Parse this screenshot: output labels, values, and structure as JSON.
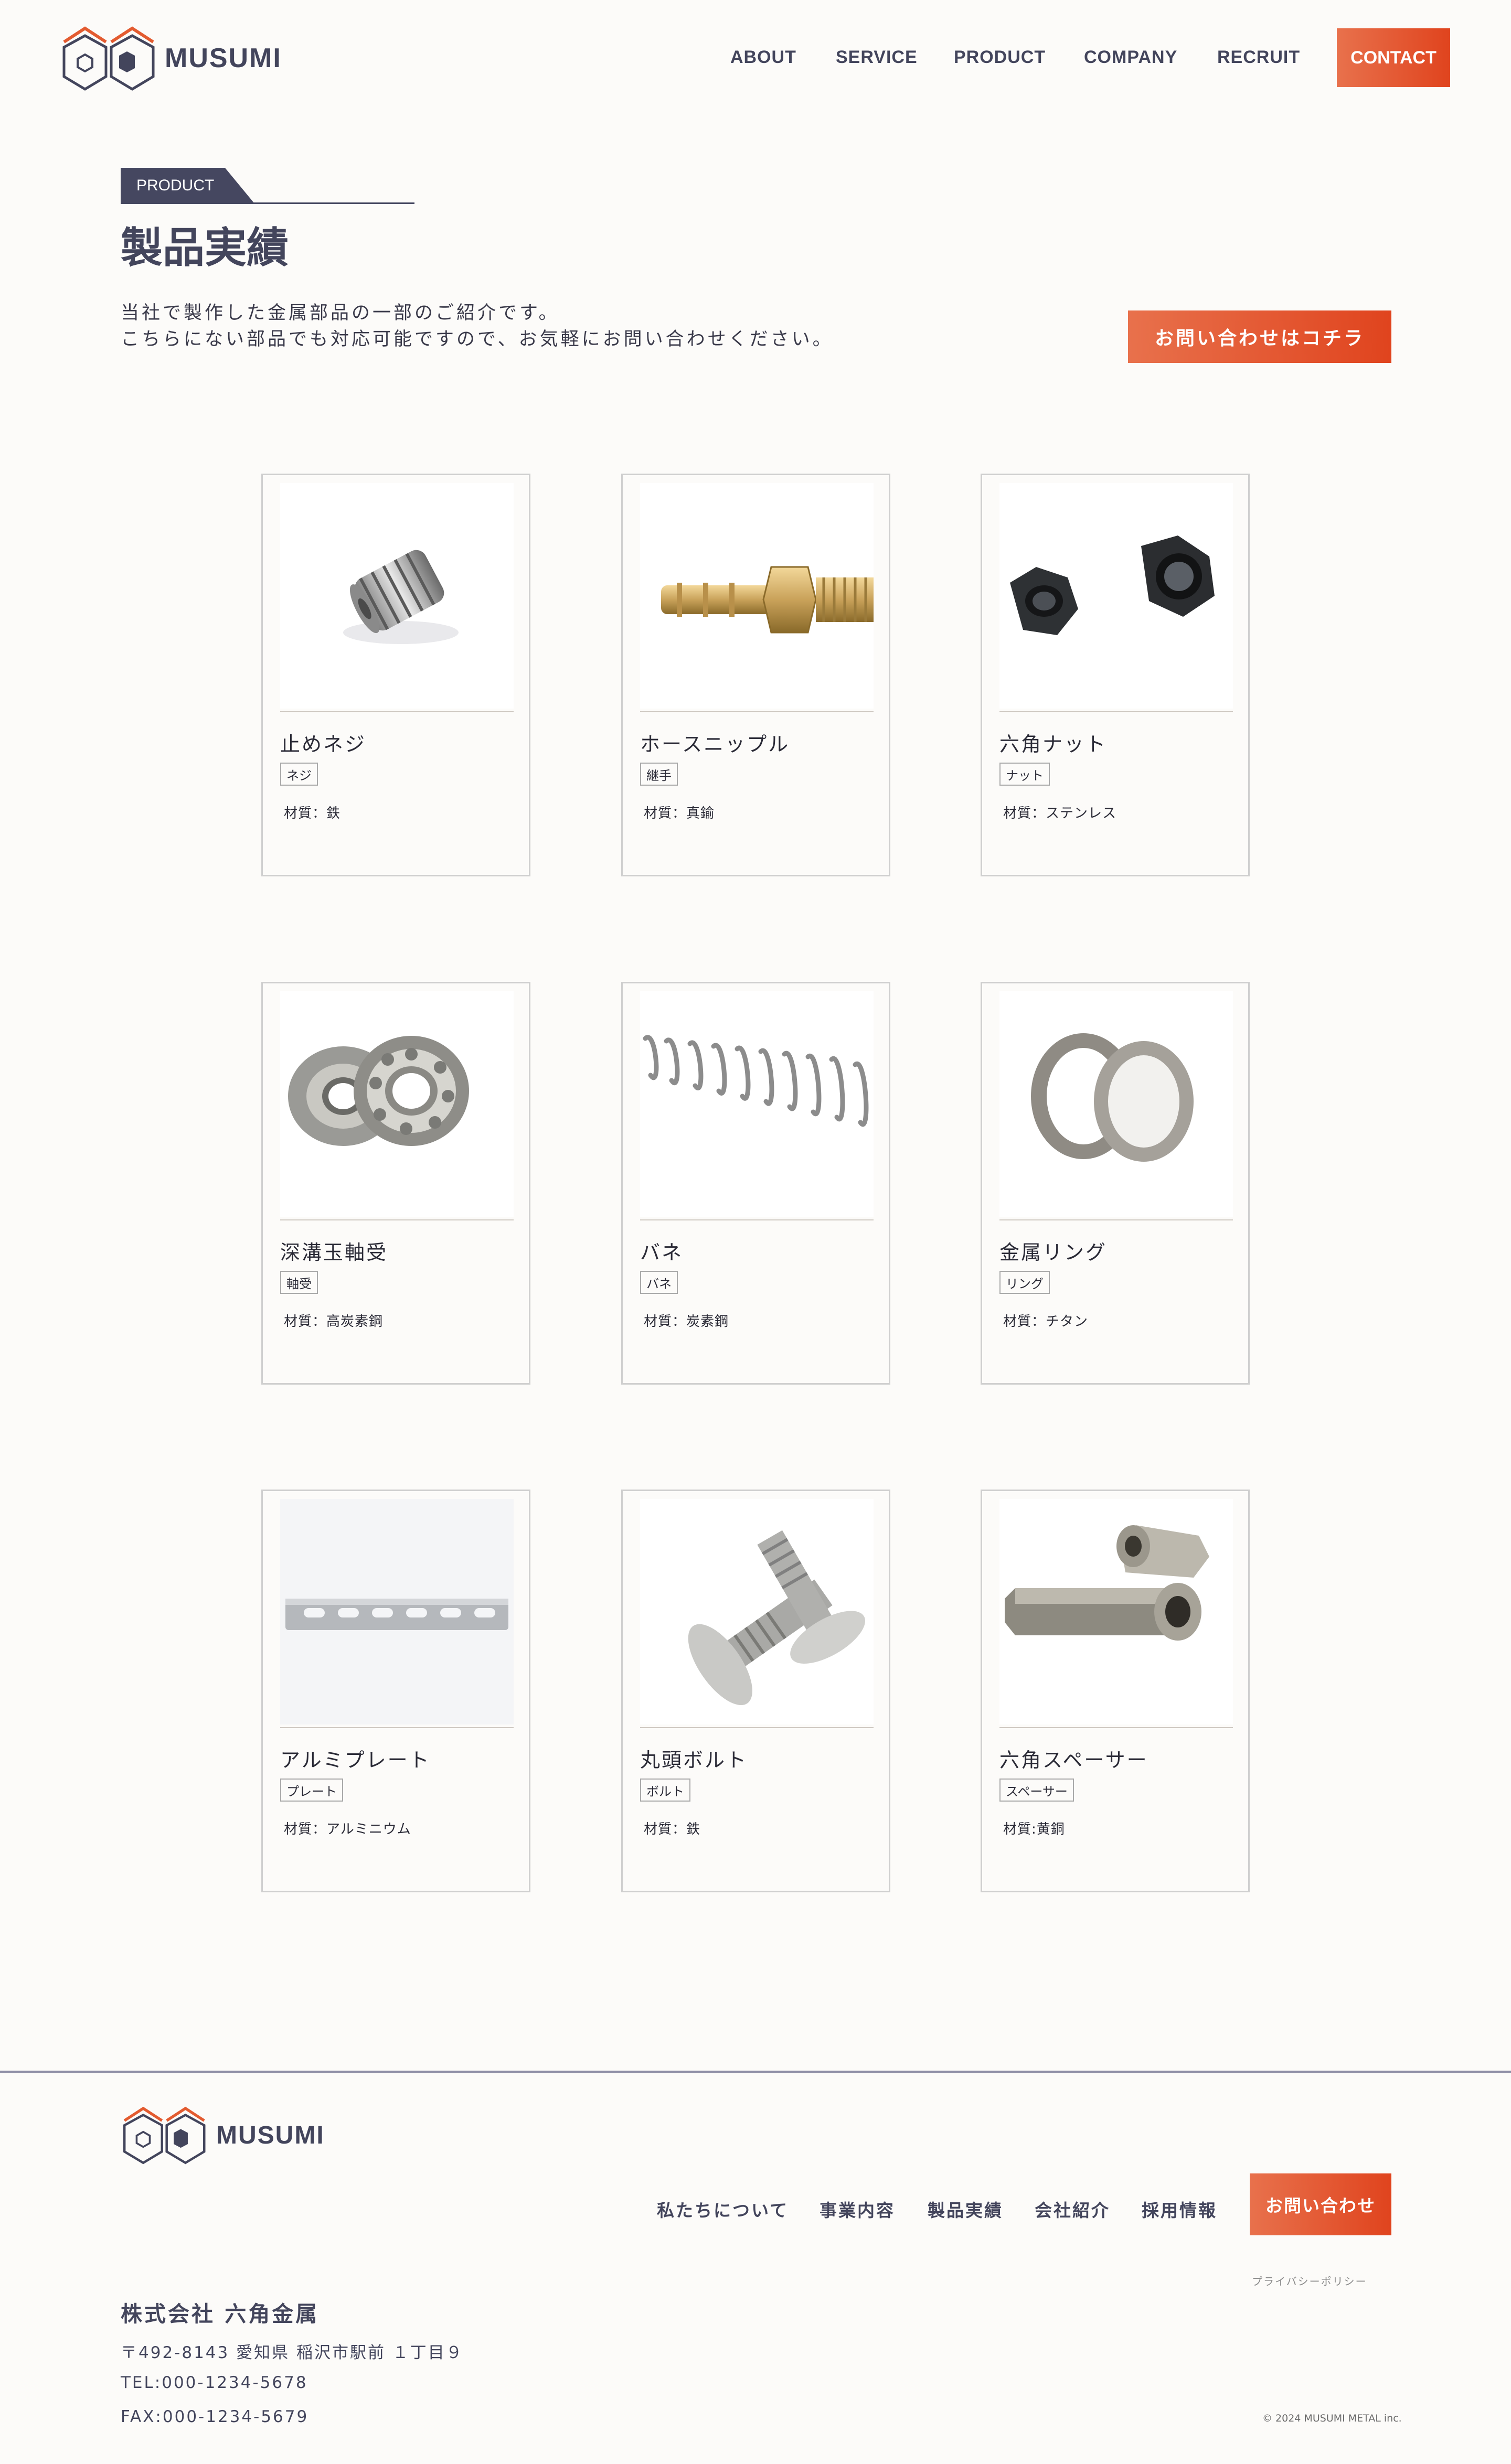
{
  "brand": {
    "name": "MUSUMI",
    "accent": "#e35b30",
    "navy": "#43455c"
  },
  "nav": {
    "items": [
      "ABOUT",
      "SERVICE",
      "PRODUCT",
      "COMPANY",
      "RECRUIT"
    ],
    "contact": "CONTACT"
  },
  "section": {
    "tag": "PRODUCT",
    "title": "製品実績",
    "intro": [
      "当社で製作した金属部品の一部のご紹介です。",
      "こちらにない部品でも対応可能ですので、お気軽にお問い合わせください。"
    ],
    "cta": "お問い合わせはコチラ"
  },
  "products": [
    {
      "name": "止めネジ",
      "tag": "ネジ",
      "material": "材質：鉄",
      "icon": "set-screw-photo"
    },
    {
      "name": "ホースニップル",
      "tag": "継手",
      "material": "材質：真鍮",
      "icon": "hose-nipple-photo"
    },
    {
      "name": "六角ナット",
      "tag": "ナット",
      "material": "材質：ステンレス",
      "icon": "hex-nut-photo"
    },
    {
      "name": "深溝玉軸受",
      "tag": "軸受",
      "material": "材質：高炭素鋼",
      "icon": "ball-bearing-photo"
    },
    {
      "name": "バネ",
      "tag": "バネ",
      "material": "材質：炭素鋼",
      "icon": "spring-photo"
    },
    {
      "name": "金属リング",
      "tag": "リング",
      "material": "材質：チタン",
      "icon": "metal-ring-photo"
    },
    {
      "name": "アルミプレート",
      "tag": "プレート",
      "material": "材質：アルミニウム",
      "icon": "aluminum-plate-photo"
    },
    {
      "name": "丸頭ボルト",
      "tag": "ボルト",
      "material": "材質：鉄",
      "icon": "round-head-bolt-photo"
    },
    {
      "name": "六角スペーサー",
      "tag": "スペーサー",
      "material": "材質:黄銅",
      "icon": "hex-spacer-photo"
    }
  ],
  "footer": {
    "nav": [
      "私たちについて",
      "事業内容",
      "製品実績",
      "会社紹介",
      "採用情報"
    ],
    "contact": "お問い合わせ",
    "privacy": "プライバシーポリシー",
    "company": "株式会社 六角金属",
    "address": "〒492-8143 愛知県 稲沢市駅前 １丁目９",
    "tel": "TEL:000-1234-5678",
    "fax": "FAX:000-1234-5679",
    "copyright": "© 2024 MUSUMI METAL inc."
  }
}
